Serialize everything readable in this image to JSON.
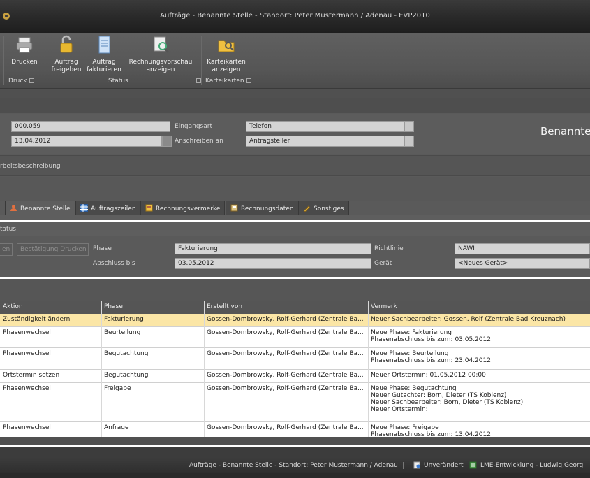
{
  "window": {
    "title": "Aufträge - Benannte Stelle - Standort: Peter Mustermann / Adenau - EVP2010"
  },
  "ribbon": {
    "buttons": [
      {
        "label1": "Drucken",
        "label2": ""
      },
      {
        "label1": "Auftrag",
        "label2": "freigeben"
      },
      {
        "label1": "Auftrag",
        "label2": "fakturieren"
      },
      {
        "label1": "Rechnungsvorschau",
        "label2": "anzeigen"
      },
      {
        "label1": "Karteikarten",
        "label2": "anzeigen"
      }
    ],
    "groups": {
      "druck": "Druck",
      "status": "Status",
      "karteikarten": "Karteikarten"
    }
  },
  "header_form": {
    "number_value": "000.059",
    "date_value": "13.04.2012",
    "eingangsart_label": "Eingangsart",
    "eingangsart_value": "Telefon",
    "anschreiben_label": "Anschreiben an",
    "anschreiben_value": "Antragsteller",
    "section_title": "Benannte",
    "arbeitsbeschreibung_label": "rbeitsbeschreibung"
  },
  "tabs": [
    {
      "label": "Benannte Stelle",
      "icon": "user-icon"
    },
    {
      "label": "Auftragszeilen",
      "icon": "grid-icon"
    },
    {
      "label": "Rechnungsvermerke",
      "icon": "note-icon"
    },
    {
      "label": "Rechnungsdaten",
      "icon": "calc-icon"
    },
    {
      "label": "Sonstiges",
      "icon": "pencil-icon"
    }
  ],
  "status_section": {
    "title": "tatus",
    "btn_left": "en",
    "btn_bestaetigung": "Bestätigung Drucken",
    "phase_label": "Phase",
    "phase_value": "Fakturierung",
    "abschluss_label": "Abschluss bis",
    "abschluss_value": "03.05.2012",
    "richtlinie_label": "Richtlinie",
    "richtlinie_value": "NAWI",
    "geraet_label": "Gerät",
    "geraet_value": "<Neues Gerät>"
  },
  "table": {
    "columns": [
      "Aktion",
      "Phase",
      "Erstellt von",
      "Vermerk"
    ],
    "rows": [
      {
        "aktion": "Zuständigkeit ändern",
        "phase": "Fakturierung",
        "erstellt": "Gossen-Dombrowsky, Rolf-Gerhard (Zentrale Ba...",
        "vermerk": [
          "Neuer Sachbearbeiter: Gossen, Rolf (Zentrale Bad Kreuznach)"
        ]
      },
      {
        "aktion": "Phasenwechsel",
        "phase": "Beurteilung",
        "erstellt": "Gossen-Dombrowsky, Rolf-Gerhard (Zentrale Ba...",
        "vermerk": [
          "Neue Phase: Fakturierung",
          "Phasenabschluss bis zum: 03.05.2012"
        ]
      },
      {
        "aktion": "Phasenwechsel",
        "phase": "Begutachtung",
        "erstellt": "Gossen-Dombrowsky, Rolf-Gerhard (Zentrale Ba...",
        "vermerk": [
          "Neue Phase: Beurteilung",
          "Phasenabschluss bis zum: 23.04.2012"
        ]
      },
      {
        "aktion": "Ortstermin setzen",
        "phase": "Begutachtung",
        "erstellt": "Gossen-Dombrowsky, Rolf-Gerhard (Zentrale Ba...",
        "vermerk": [
          "Neuer Ortstermin: 01.05.2012 00:00"
        ]
      },
      {
        "aktion": "Phasenwechsel",
        "phase": "Freigabe",
        "erstellt": "Gossen-Dombrowsky, Rolf-Gerhard (Zentrale Ba...",
        "vermerk": [
          "Neue Phase: Begutachtung",
          "Neuer Gutachter: Born, Dieter (TS Koblenz)",
          "Neuer Sachbearbeiter: Born, Dieter (TS Koblenz)",
          "Neuer Ortstermin:"
        ]
      },
      {
        "aktion": "Phasenwechsel",
        "phase": "Anfrage",
        "erstellt": "Gossen-Dombrowsky, Rolf-Gerhard (Zentrale Ba...",
        "vermerk": [
          "Neue Phase: Freigabe",
          "Phasenabschluss bis zum: 13.04.2012"
        ]
      }
    ]
  },
  "statusbar": {
    "window_text": "Aufträge - Benannte Stelle - Standort: Peter Mustermann / Adenau",
    "state": "Unverändert",
    "env": "LME-Entwicklung - Ludwig,Georg"
  },
  "colors": {
    "selected_row": "#fbe6a6",
    "background": "#5a5a5a"
  }
}
